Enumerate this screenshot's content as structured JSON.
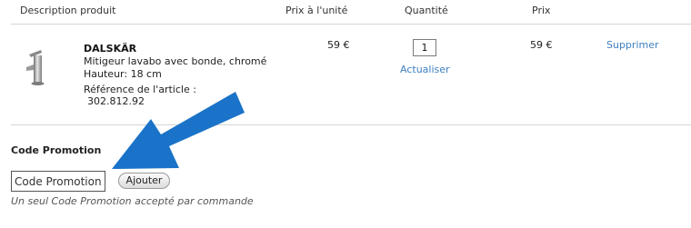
{
  "table": {
    "headers": {
      "description": "Description produit",
      "unit_price": "Prix à l'unité",
      "quantity": "Quantité",
      "price": "Prix"
    }
  },
  "item": {
    "name": "DALSKÄR",
    "description": "Mitigeur lavabo avec bonde, chromé",
    "height": "Hauteur: 18 cm",
    "reference_label": "Référence de l'article :",
    "reference_number": "302.812.92",
    "unit_price": "59 €",
    "quantity": "1",
    "update_label": "Actualiser",
    "total_price": "59 €",
    "remove_label": "Supprimer"
  },
  "promo": {
    "title": "Code Promotion",
    "input_placeholder": "Code Promotion",
    "add_label": "Ajouter",
    "note": "Un seul Code Promotion accepté par commande"
  },
  "colors": {
    "link": "#3d7fbf",
    "arrow": "#1a73c8"
  }
}
